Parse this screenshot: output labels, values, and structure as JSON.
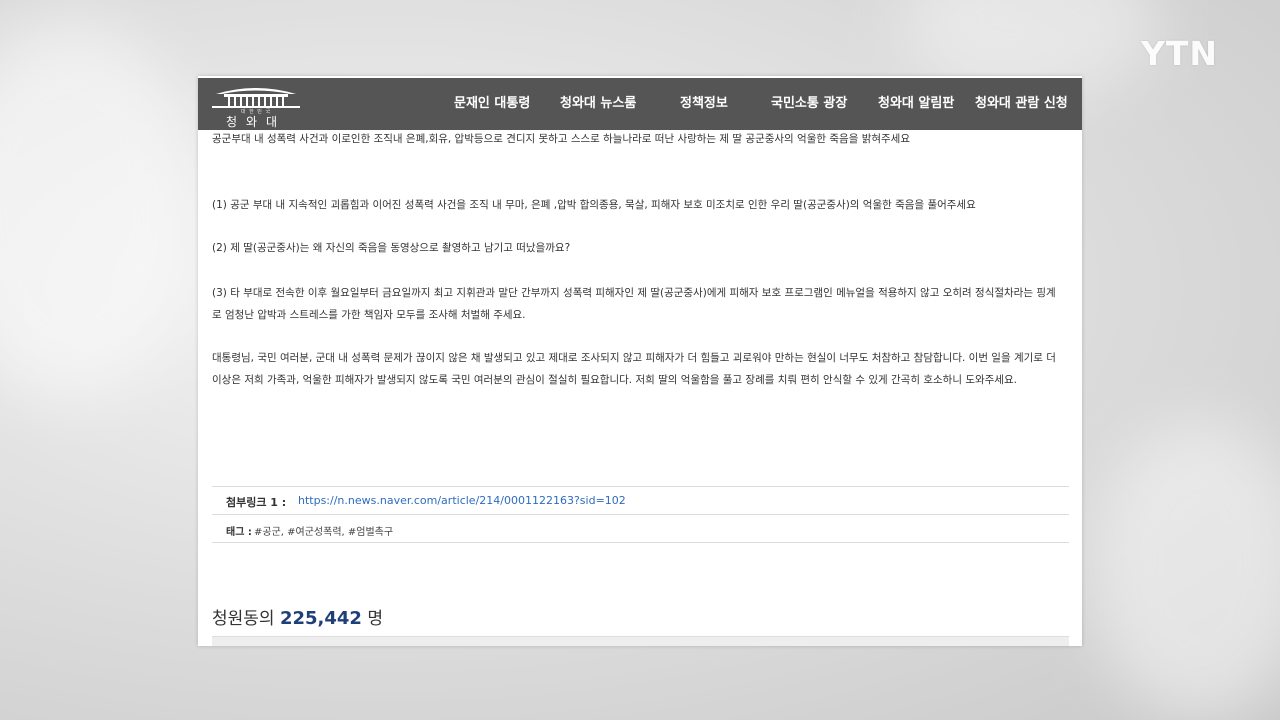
{
  "broadcaster": {
    "logo_text": "YTN"
  },
  "site": {
    "logo_sub": "대 한 민 국",
    "logo_main": "청와대",
    "nav": [
      "문재인 대통령",
      "청와대 뉴스룸",
      "정책정보",
      "국민소통 광장",
      "청와대 알림판",
      "청와대 관람 신청"
    ]
  },
  "petition": {
    "paragraphs": [
      "공군부대 내 성폭력 사건과 이로인한 조직내 은폐,회유, 압박등으로 견디지 못하고 스스로 하늘나라로 떠난 사랑하는 제 딸 공군중사의 억울한 죽음을 밝혀주세요",
      "(1) 공군 부대 내 지속적인 괴롭힘과 이어진 성폭력 사건을 조직 내 무마, 은폐 ,압박 합의종용, 묵살, 피해자 보호 미조치로  인한 우리 딸(공군중사)의 억울한 죽음을 풀어주세요",
      "(2) 제 딸(공군중사)는 왜 자신의 죽음을 동영상으로 촬영하고 남기고 떠났을까요?",
      "(3) 타 부대로 전속한 이후 월요일부터 금요일까지 최고 지휘관과 말단 간부까지 성폭력 피해자인 제 딸(공군중사)에게 피해자 보호 프로그램인  메뉴얼을 적용하지 않고 오히려 정식절차라는 핑계로 엄청난 압박과 스트레스를 가한 책임자 모두를 조사해  처벌해 주세요.",
      "대통령님, 국민 여러분, 군대 내 성폭력 문제가 끊이지 않은 채 발생되고 있고 제대로 조사되지 않고 피해자가 더 힘들고 괴로워야 만하는 현실이 너무도 처참하고 참담합니다. 이번 일을 계기로 더 이상은 저희 가족과, 억울한 피해자가 발생되지 않도록 국민 여러분의 관심이 절실히 필요합니다. 저희 딸의 억울함을 풀고 장례를 치뤄 편히 안식할 수 있게 간곡히 호소하니 도와주세요."
    ],
    "attachment_label": "첨부링크 1 :",
    "attachment_url": "https://n.news.naver.com/article/214/0001122163?sid=102",
    "tags_label": "태그 :",
    "tags": [
      "#공군,",
      "#여군성폭력,",
      "#엄벌촉구"
    ],
    "signers_prefix": "청원동의",
    "signers_count": "225,442",
    "signers_suffix": "명"
  },
  "colors": {
    "nav_background": "#555555",
    "link": "#2e6cc0",
    "count": "#1e3f78"
  }
}
